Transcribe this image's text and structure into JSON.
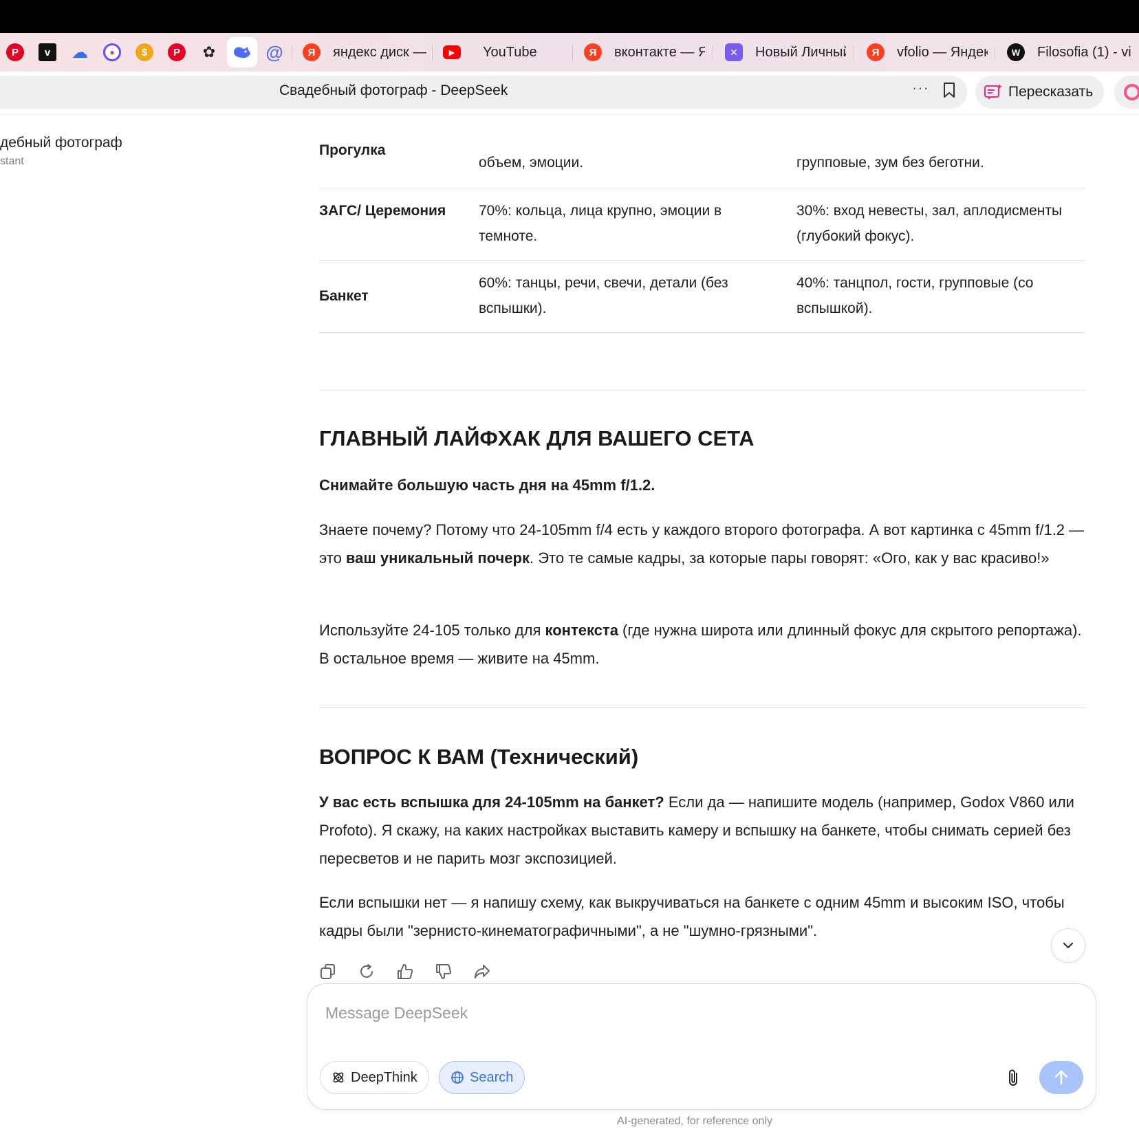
{
  "browser": {
    "pinned_tabs": [
      {
        "icon": "pinterest-icon",
        "color": "#e60023",
        "glyph": "P"
      },
      {
        "icon": "vimeo-icon",
        "color": "#111111",
        "glyph": "v"
      },
      {
        "icon": "cloud-icon",
        "color": "#2f6fe8",
        "glyph": "☁"
      },
      {
        "icon": "circle-logo-icon",
        "color": "#6a4bff",
        "glyph": "◉"
      },
      {
        "icon": "coins-icon",
        "color": "#f0a81a",
        "glyph": "●"
      },
      {
        "icon": "pinterest-icon",
        "color": "#e60023",
        "glyph": "P"
      },
      {
        "icon": "flower-icon",
        "color": "#222222",
        "glyph": "✿"
      },
      {
        "icon": "whale-icon",
        "color": "#4d6bfe",
        "glyph": "◆"
      },
      {
        "icon": "at-sign-icon",
        "color": "#5b6cf0",
        "glyph": "@"
      }
    ],
    "tabs": [
      {
        "title": "яндекс диск —",
        "icon": "yandex-icon",
        "color": "#fc3f1d",
        "glyph": "Я"
      },
      {
        "title": "YouTube",
        "icon": "youtube-icon",
        "color": "#ff0000",
        "glyph": "▶"
      },
      {
        "title": "вконтакте — Ян",
        "icon": "yandex-icon",
        "color": "#fc3f1d",
        "glyph": "Я"
      },
      {
        "title": "Новый Личный",
        "icon": "clickup-icon",
        "color": "#7b5cf0",
        "glyph": "✕"
      },
      {
        "title": "vfolio — Яндекс",
        "icon": "yandex-icon",
        "color": "#fc3f1d",
        "glyph": "Я"
      },
      {
        "title": "Filosofia (1) - vi",
        "icon": "w-icon",
        "color": "#111111",
        "glyph": "W"
      }
    ],
    "page_title": "Свадебный фотограф - DeepSeek",
    "more_label": "···",
    "retell_label": "Пересказать"
  },
  "chat": {
    "title": "дебный фотограф",
    "subtitle": "stant"
  },
  "table": {
    "rows": [
      {
        "c1": "Прогулка",
        "c2": "объем, эмоции.",
        "c3": "групповые, зум без беготни."
      },
      {
        "c1": "ЗАГС/ Церемония",
        "c2": "70%: кольца, лица крупно, эмоции в темноте.",
        "c3": "30%: вход невесты, зал, аплодисменты (глубокий фокус)."
      },
      {
        "c1": "Банкет",
        "c2": "60%: танцы, речи, свечи, детали (без вспышки).",
        "c3": "40%: танцпол, гости, групповые (со вспышкой)."
      }
    ]
  },
  "section1": {
    "heading": "ГЛАВНЫЙ ЛАЙФХАК ДЛЯ ВАШЕГО СЕТА",
    "lead": "Снимайте большую часть дня на 45mm f/1.2.",
    "p1_a": "Знаете почему? Потому что 24-105mm f/4 есть у каждого второго фотографа. А вот картинка с 45mm f/1.2 — это ",
    "p1_b": "ваш уникальный почерк",
    "p1_c": ". Это те самые кадры, за которые пары говорят: «Ого, как у вас красиво!»",
    "p2_a": "Используйте 24-105 только для ",
    "p2_b": "контекста",
    "p2_c": " (где нужна широта или длинный фокус для скрытого репортажа). В остальное время — живите на 45mm."
  },
  "section2": {
    "heading": "ВОПРОС К ВАМ (Технический)",
    "p1_b": "У вас есть вспышка для 24-105mm на банкет?",
    "p1_c": " Если да — напишите модель (например, Godox V860 или Profoto). Я скажу, на каких настройках выставить камеру и вспышку на банкете, чтобы снимать серией без пересветов и не парить мозг экспозицией.",
    "p2": "Если вспышки нет — я напишу схему, как выкручиваться на банкете с одним 45mm и высоким ISO, чтобы кадры были \"зернисто-кинематографичными\", а не \"шумно-грязными\"."
  },
  "composer": {
    "placeholder": "Message DeepSeek",
    "value": "",
    "deepthink_label": "DeepThink",
    "search_label": "Search",
    "accent": "#3b6fe0",
    "send_color": "#a8c4fb"
  },
  "footnote": "AI-generated, for reference only"
}
